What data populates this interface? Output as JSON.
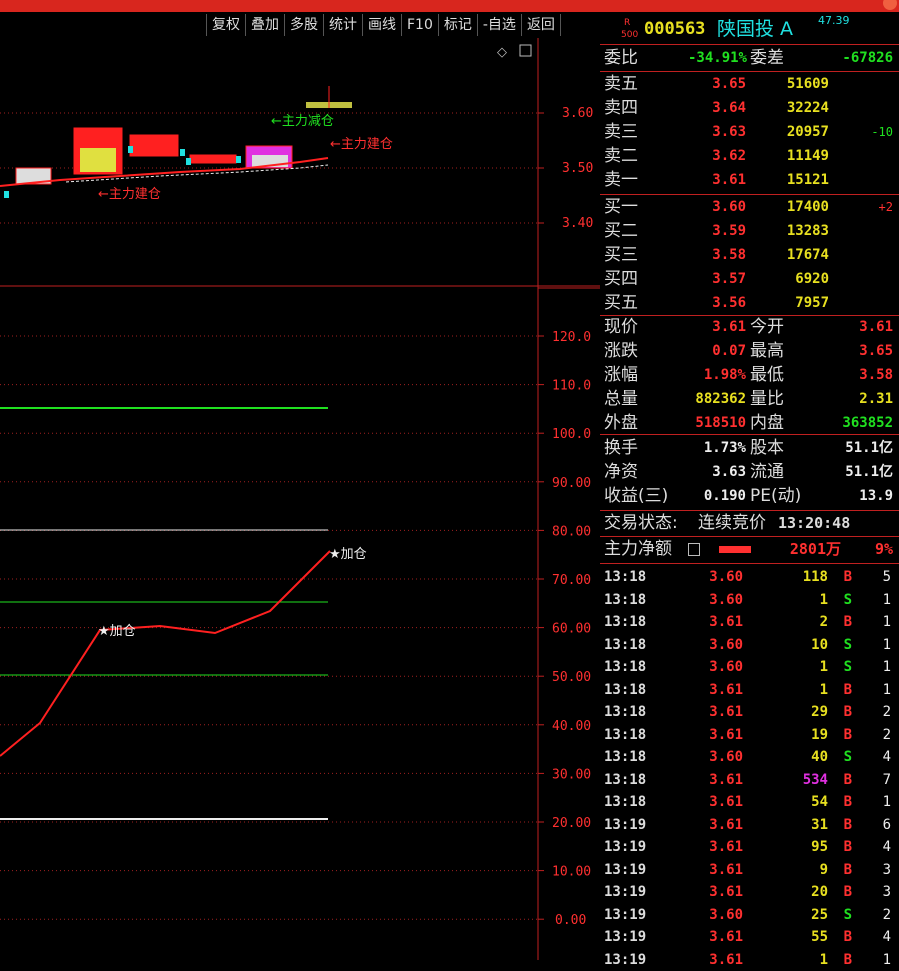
{
  "toolbar": {
    "buttons": [
      "复权",
      "叠加",
      "多股",
      "统计",
      "画线",
      "F10",
      "标记",
      "-自选",
      "返回"
    ]
  },
  "stock": {
    "code": "000563",
    "name": "陕国投 A",
    "badge_top": "R",
    "badge_bottom": "500",
    "extra": "47.39"
  },
  "price_axis": [
    "3.60",
    "3.50",
    "3.40"
  ],
  "indicator_axis": [
    "120.0",
    "110.0",
    "100.0",
    "90.00",
    "80.00",
    "70.00",
    "60.00",
    "50.00",
    "40.00",
    "30.00",
    "20.00",
    "10.00",
    "0.00"
  ],
  "annotations": {
    "build1": "←主力建仓",
    "build2": "←主力建仓",
    "reduce": "←主力减仓",
    "add1": "★加仓",
    "add2": "★加仓"
  },
  "weibi": {
    "label": "委比",
    "value": "-34.91%",
    "label2": "委差",
    "value2": "-67826"
  },
  "asks": [
    {
      "label": "卖五",
      "price": "3.65",
      "vol": "51609",
      "chg": ""
    },
    {
      "label": "卖四",
      "price": "3.64",
      "vol": "32224",
      "chg": ""
    },
    {
      "label": "卖三",
      "price": "3.63",
      "vol": "20957",
      "chg": "-10"
    },
    {
      "label": "卖二",
      "price": "3.62",
      "vol": "11149",
      "chg": ""
    },
    {
      "label": "卖一",
      "price": "3.61",
      "vol": "15121",
      "chg": ""
    }
  ],
  "bids": [
    {
      "label": "买一",
      "price": "3.60",
      "vol": "17400",
      "chg": "+2"
    },
    {
      "label": "买二",
      "price": "3.59",
      "vol": "13283",
      "chg": ""
    },
    {
      "label": "买三",
      "price": "3.58",
      "vol": "17674",
      "chg": ""
    },
    {
      "label": "买四",
      "price": "3.57",
      "vol": "6920",
      "chg": ""
    },
    {
      "label": "买五",
      "price": "3.56",
      "vol": "7957",
      "chg": ""
    }
  ],
  "quote": [
    {
      "l1": "现价",
      "v1": "3.61",
      "c1": "red",
      "l2": "今开",
      "v2": "3.61",
      "c2": "red"
    },
    {
      "l1": "涨跌",
      "v1": "0.07",
      "c1": "red",
      "l2": "最高",
      "v2": "3.65",
      "c2": "red"
    },
    {
      "l1": "涨幅",
      "v1": "1.98%",
      "c1": "red",
      "l2": "最低",
      "v2": "3.58",
      "c2": "red"
    },
    {
      "l1": "总量",
      "v1": "882362",
      "c1": "yellow",
      "l2": "量比",
      "v2": "2.31",
      "c2": "yellow"
    },
    {
      "l1": "外盘",
      "v1": "518510",
      "c1": "red",
      "l2": "内盘",
      "v2": "363852",
      "c2": "green"
    }
  ],
  "fundamentals": [
    {
      "l1": "换手",
      "v1": "1.73%",
      "l2": "股本",
      "v2": "51.1亿"
    },
    {
      "l1": "净资",
      "v1": "3.63",
      "l2": "流通",
      "v2": "51.1亿"
    },
    {
      "l1": "收益(三)",
      "v1": "0.190",
      "l2": "PE(动)",
      "v2": "13.9"
    }
  ],
  "status": {
    "label": "交易状态:",
    "value": "连续竞价",
    "time": "13:20:48"
  },
  "main_net": {
    "label": "主力净额",
    "amount": "2801万",
    "pct": "9%"
  },
  "trades": [
    {
      "t": "13:18",
      "p": "3.60",
      "pc": "red",
      "v": "118",
      "vc": "yellow",
      "d": "B",
      "n": "5"
    },
    {
      "t": "13:18",
      "p": "3.60",
      "pc": "red",
      "v": "1",
      "vc": "yellow",
      "d": "S",
      "n": "1"
    },
    {
      "t": "13:18",
      "p": "3.61",
      "pc": "red",
      "v": "2",
      "vc": "yellow",
      "d": "B",
      "n": "1"
    },
    {
      "t": "13:18",
      "p": "3.60",
      "pc": "red",
      "v": "10",
      "vc": "yellow",
      "d": "S",
      "n": "1"
    },
    {
      "t": "13:18",
      "p": "3.60",
      "pc": "red",
      "v": "1",
      "vc": "yellow",
      "d": "S",
      "n": "1"
    },
    {
      "t": "13:18",
      "p": "3.61",
      "pc": "red",
      "v": "1",
      "vc": "yellow",
      "d": "B",
      "n": "1"
    },
    {
      "t": "13:18",
      "p": "3.61",
      "pc": "red",
      "v": "29",
      "vc": "yellow",
      "d": "B",
      "n": "2"
    },
    {
      "t": "13:18",
      "p": "3.61",
      "pc": "red",
      "v": "19",
      "vc": "yellow",
      "d": "B",
      "n": "2"
    },
    {
      "t": "13:18",
      "p": "3.60",
      "pc": "red",
      "v": "40",
      "vc": "yellow",
      "d": "S",
      "n": "4"
    },
    {
      "t": "13:18",
      "p": "3.61",
      "pc": "red",
      "v": "534",
      "vc": "purple",
      "d": "B",
      "n": "7"
    },
    {
      "t": "13:18",
      "p": "3.61",
      "pc": "red",
      "v": "54",
      "vc": "yellow",
      "d": "B",
      "n": "1"
    },
    {
      "t": "13:19",
      "p": "3.61",
      "pc": "red",
      "v": "31",
      "vc": "yellow",
      "d": "B",
      "n": "6"
    },
    {
      "t": "13:19",
      "p": "3.61",
      "pc": "red",
      "v": "95",
      "vc": "yellow",
      "d": "B",
      "n": "4"
    },
    {
      "t": "13:19",
      "p": "3.61",
      "pc": "red",
      "v": "9",
      "vc": "yellow",
      "d": "B",
      "n": "3"
    },
    {
      "t": "13:19",
      "p": "3.61",
      "pc": "red",
      "v": "20",
      "vc": "yellow",
      "d": "B",
      "n": "3"
    },
    {
      "t": "13:19",
      "p": "3.60",
      "pc": "red",
      "v": "25",
      "vc": "yellow",
      "d": "S",
      "n": "2"
    },
    {
      "t": "13:19",
      "p": "3.61",
      "pc": "red",
      "v": "55",
      "vc": "yellow",
      "d": "B",
      "n": "4"
    },
    {
      "t": "13:19",
      "p": "3.61",
      "pc": "red",
      "v": "1",
      "vc": "yellow",
      "d": "B",
      "n": "1"
    }
  ]
}
